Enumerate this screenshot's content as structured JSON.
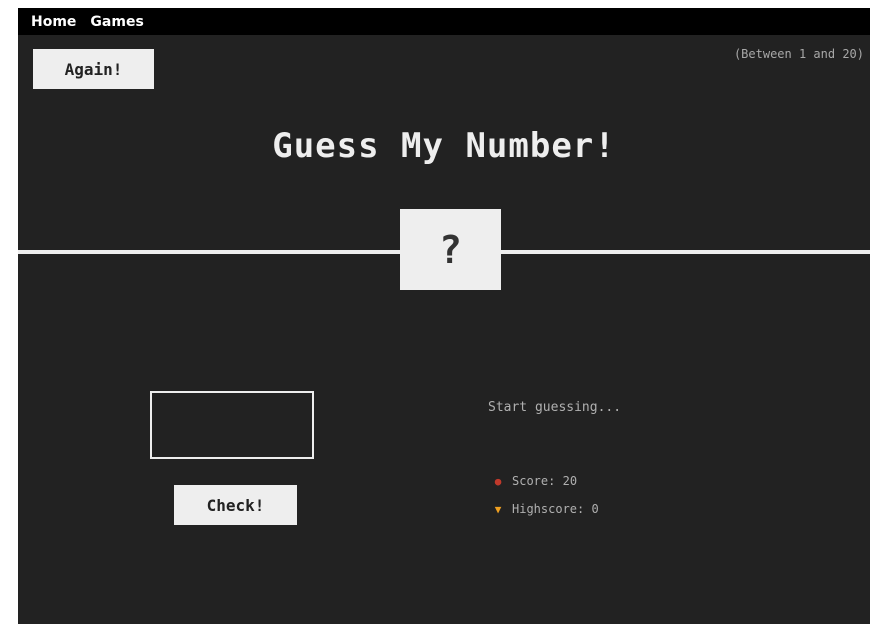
{
  "nav": {
    "items": [
      {
        "label": "Home"
      },
      {
        "label": "Games"
      }
    ]
  },
  "header": {
    "again_label": "Again!",
    "range_hint": "(Between 1 and 20)"
  },
  "main": {
    "title": "Guess My Number!",
    "secret_display": "?",
    "check_label": "Check!",
    "guess_value": "",
    "message": "Start guessing...",
    "score_label": "Score:",
    "score_value": "20",
    "highscore_label": "Highscore:",
    "highscore_value": "0",
    "icons": {
      "score": "score-icon",
      "highscore": "trophy-icon"
    }
  },
  "colors": {
    "background": "#222222",
    "foreground": "#eeeeee",
    "navbar": "#000000"
  }
}
